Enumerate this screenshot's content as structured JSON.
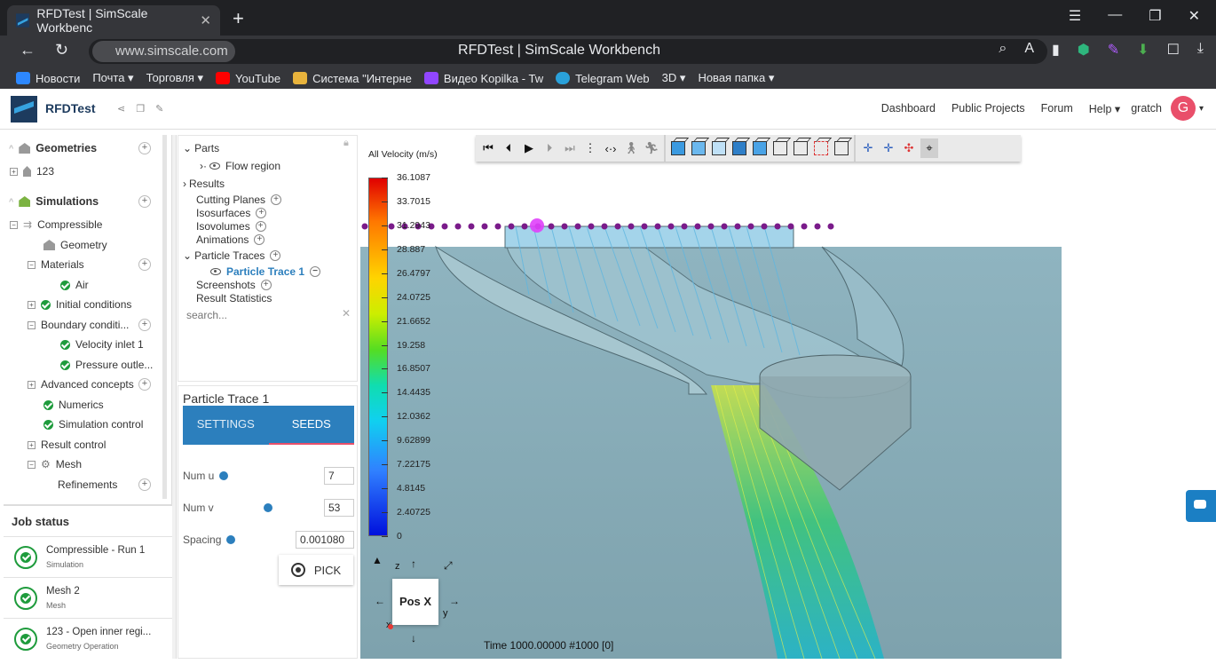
{
  "browser": {
    "tab_title": "RFDTest | SimScale Workbenc",
    "page_title": "RFDTest | SimScale Workbench",
    "url": "www.simscale.com",
    "bookmarks": [
      {
        "label": "Новости",
        "color": "#2d88ff"
      },
      {
        "label": "Почта ▾",
        "color": ""
      },
      {
        "label": "Торговля ▾",
        "color": ""
      },
      {
        "label": "YouTube",
        "color": "#ff0000"
      },
      {
        "label": "Система \"Интерне",
        "color": "#e8b33c"
      },
      {
        "label": "Видео Kopilka - Tw",
        "color": "#9146ff"
      },
      {
        "label": "Telegram Web",
        "color": "#2aa1da"
      },
      {
        "label": "3D ▾",
        "color": ""
      },
      {
        "label": "Новая папка ▾",
        "color": ""
      }
    ]
  },
  "header": {
    "project": "RFDTest",
    "nav": [
      "Dashboard",
      "Public Projects",
      "Forum",
      "Help ▾"
    ],
    "user": "gratch",
    "avatar_letter": "G",
    "avatar_color": "#e94f6a"
  },
  "tree": {
    "geometries": "Geometries",
    "geometry_item": "123",
    "simulations": "Simulations",
    "compressible": "Compressible",
    "geometry": "Geometry",
    "materials": "Materials",
    "air": "Air",
    "initial_conditions": "Initial conditions",
    "boundary_conditions": "Boundary conditi...",
    "velocity_inlet": "Velocity inlet 1",
    "pressure_outlet": "Pressure outle...",
    "advanced_concepts": "Advanced concepts",
    "numerics": "Numerics",
    "simulation_control": "Simulation control",
    "result_control": "Result control",
    "mesh": "Mesh",
    "refinements": "Refinements"
  },
  "jobs": {
    "title": "Job status",
    "items": [
      {
        "name": "Compressible - Run 1",
        "type": "Simulation"
      },
      {
        "name": "Mesh 2",
        "type": "Mesh"
      },
      {
        "name": "123 - Open inner regi...",
        "type": "Geometry Operation"
      }
    ]
  },
  "post": {
    "parts": "Parts",
    "flow_region": "Flow region",
    "results": "Results",
    "cutting_planes": "Cutting Planes",
    "isosurfaces": "Isosurfaces",
    "isovolumes": "Isovolumes",
    "animations": "Animations",
    "particle_traces": "Particle Traces",
    "particle_trace_1": "Particle Trace 1",
    "screenshots": "Screenshots",
    "result_statistics": "Result Statistics",
    "search_placeholder": "search..."
  },
  "particle_trace": {
    "title": "Particle Trace 1",
    "tab_settings": "SETTINGS",
    "tab_seeds": "SEEDS",
    "num_u_label": "Num u",
    "num_u": "7",
    "num_v_label": "Num v",
    "num_v": "53",
    "spacing_label": "Spacing",
    "spacing": "0.001080",
    "pick": "PICK"
  },
  "viewer": {
    "legend_title": "All Velocity (m/s)",
    "legend_ticks": [
      "36.1087",
      "33.7015",
      "31.2943",
      "28.887",
      "26.4797",
      "24.0725",
      "21.6652",
      "19.258",
      "16.8507",
      "14.4435",
      "12.0362",
      "9.62899",
      "7.22175",
      "4.8145",
      "2.40725",
      "0"
    ],
    "time": "Time 1000.00000  #1000 [0]",
    "axis_face": "Pos X",
    "axis_z": "z",
    "axis_y": "y",
    "axis_x": "x"
  }
}
